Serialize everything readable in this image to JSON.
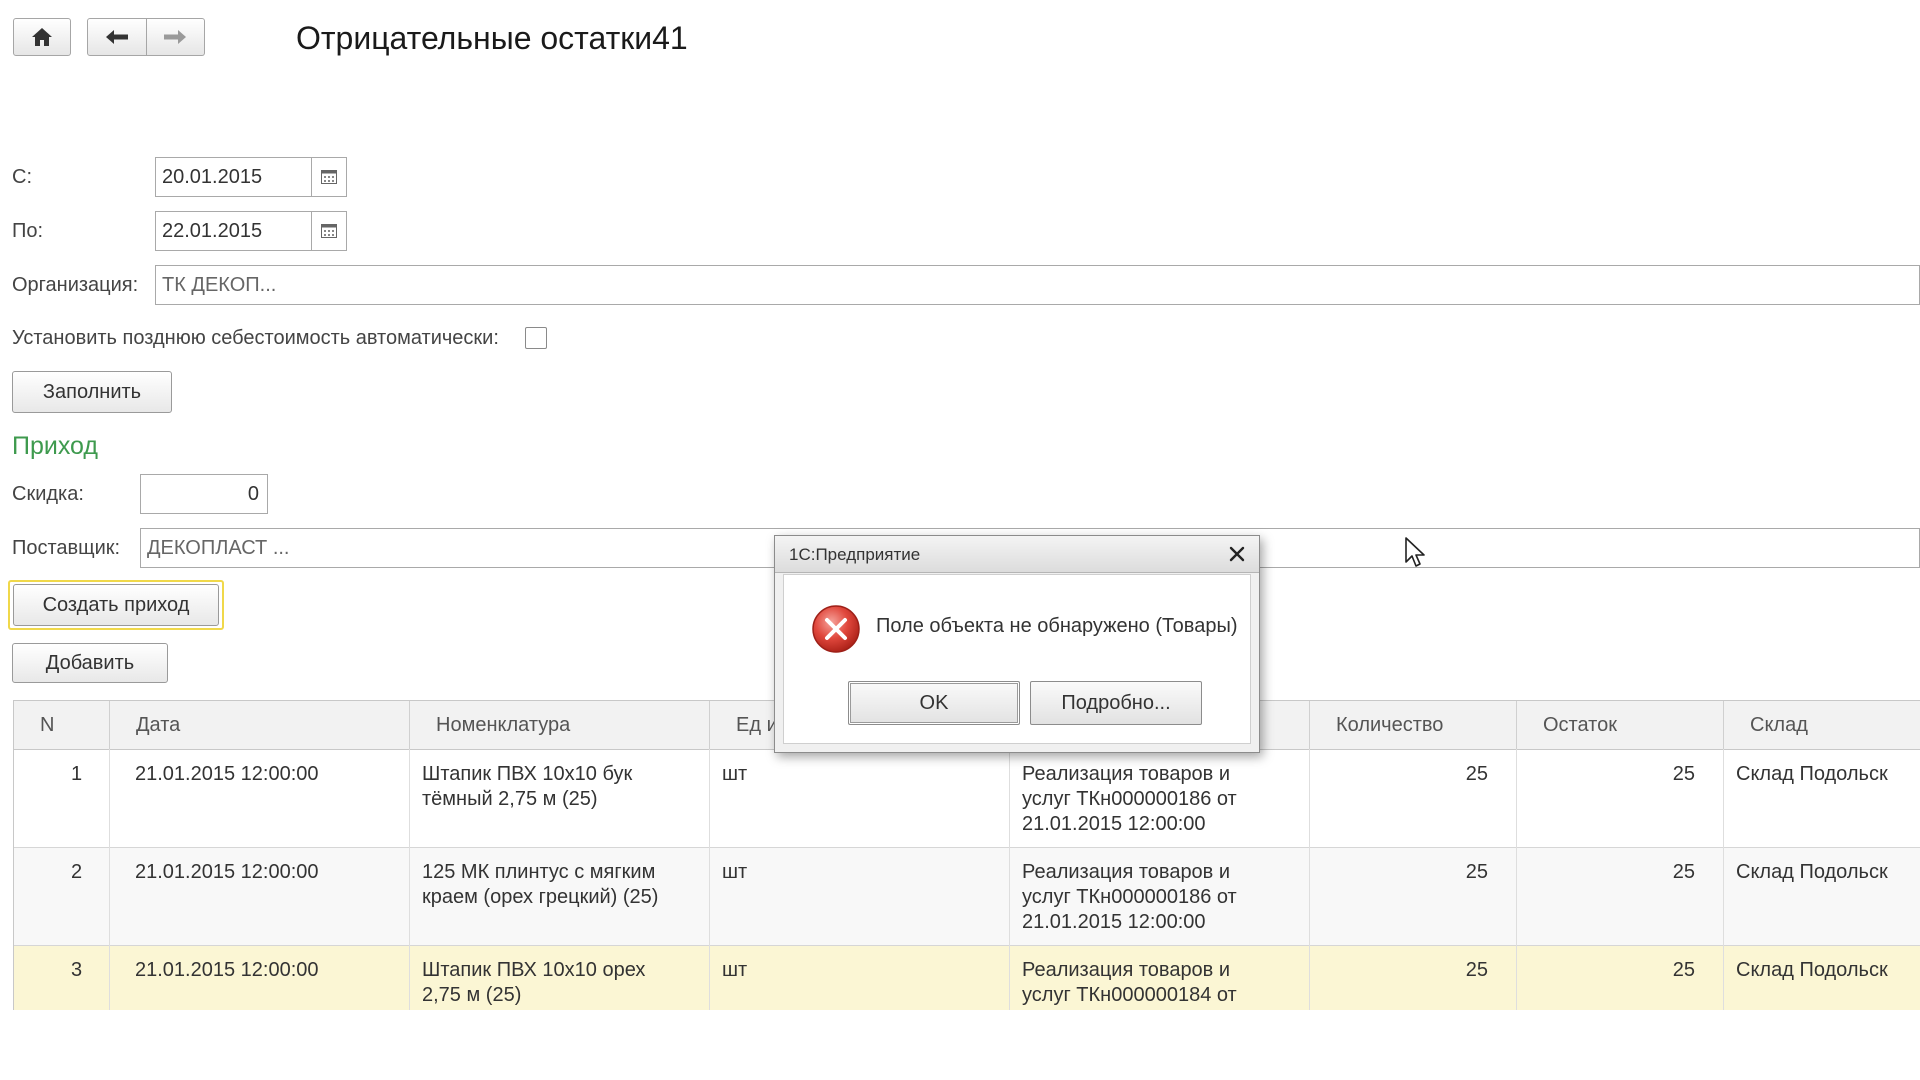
{
  "header": {
    "title": "Отрицательные остатки41"
  },
  "form": {
    "from_label": "С:",
    "from_value": "20.01.2015",
    "to_label": "По:",
    "to_value": "22.01.2015",
    "org_label": "Организация:",
    "org_value": "ТК ДЕКОП...",
    "late_cost_label": "Установить позднюю себестоимость автоматически:",
    "late_cost_checked": false,
    "fill_button": "Заполнить",
    "section_title": "Приход",
    "discount_label": "Скидка:",
    "discount_value": "0",
    "supplier_label": "Поставщик:",
    "supplier_value": "ДЕКОПЛАСТ ...",
    "create_receipt_button": "Создать приход",
    "add_button": "Добавить"
  },
  "table": {
    "columns": [
      "N",
      "Дата",
      "Номенклатура",
      "Ед из",
      "Количество",
      "Остаток",
      "Склад"
    ],
    "rows": [
      {
        "n": "1",
        "date": "21.01.2015 12:00:00",
        "item": "Штапик ПВХ 10х10 бук\nтёмный 2,75 м (25)",
        "unit": "шт",
        "doc": "Реализация товаров и\nуслуг ТКн000000186 от\n21.01.2015 12:00:00",
        "qty": "25",
        "rest": "25",
        "warehouse": "Склад Подольск"
      },
      {
        "n": "2",
        "date": "21.01.2015 12:00:00",
        "item": "125 МК плинтус с мягким\nкраем (орех грецкий) (25)",
        "unit": "шт",
        "doc": "Реализация товаров и\nуслуг ТКн000000186 от\n21.01.2015 12:00:00",
        "qty": "25",
        "rest": "25",
        "warehouse": "Склад Подольск"
      },
      {
        "n": "3",
        "date": "21.01.2015 12:00:00",
        "item": "Штапик ПВХ 10х10 орех\n2,75 м (25)",
        "unit": "шт",
        "doc": "Реализация товаров и\nуслуг ТКн000000184 от",
        "qty": "25",
        "rest": "25",
        "warehouse": "Склад Подольск"
      }
    ]
  },
  "dialog": {
    "title": "1С:Предприятие",
    "message": "Поле объекта не обнаружено (Товары)",
    "ok_button": "OK",
    "details_button": "Подробно...",
    "icon": "error-icon"
  },
  "colors": {
    "section": "#3e9a4e",
    "selected_row": "#fbf6d4",
    "focus_ring": "#f0d84a",
    "error_red": "#d9342b"
  }
}
